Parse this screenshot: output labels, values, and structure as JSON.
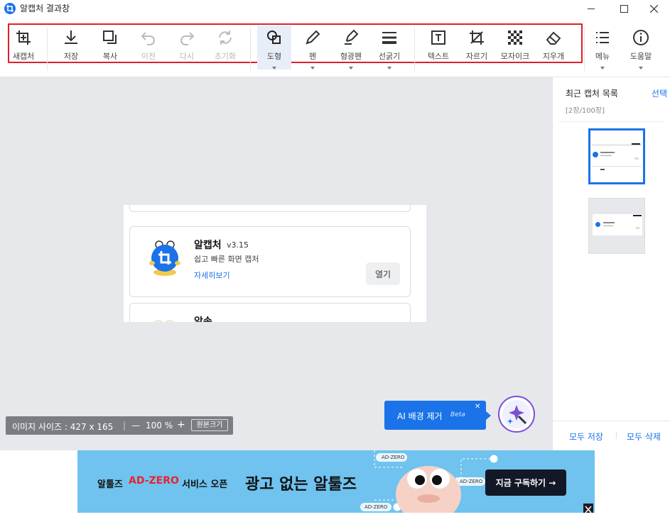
{
  "window": {
    "title": "알캡처 결과창"
  },
  "toolbar": {
    "new_capture": "새캡처",
    "save": "저장",
    "copy": "복사",
    "undo": "이전",
    "redo": "다시",
    "reset": "초기화",
    "shape": "도형",
    "pen": "펜",
    "highlighter": "형광펜",
    "line_thickness": "선굵기",
    "text": "텍스트",
    "crop": "자르기",
    "mosaic": "모자이크",
    "eraser": "지우개",
    "menu": "메뉴",
    "help": "도움말"
  },
  "canvas": {
    "app_card": {
      "name": "알캡처",
      "version": "v3.15",
      "description": "쉽고 빠른 화면 캡처",
      "details_link": "자세히보기",
      "open_button": "열기"
    },
    "next_card_title": "알송",
    "size_bar": {
      "label": "이미지 사이즈 : 427 x 165",
      "separator": "|",
      "zoom_out": "—",
      "zoom": "100 %",
      "zoom_in": "+",
      "original_size": "원본크기"
    },
    "ai_popup": {
      "label": "AI 배경 제거",
      "badge": "Beta",
      "close": "✕"
    }
  },
  "side_panel": {
    "title": "최근 캡처 목록",
    "select": "선택",
    "count": "[2장/100장]",
    "save_all": "모두 저장",
    "delete_all": "모두 삭제"
  },
  "ad": {
    "brand": "알툴즈",
    "highlight": "AD-ZERO",
    "service_open": "서비스 오픈",
    "headline": "광고 없는 알툴즈",
    "cta": "지금 구독하기 →",
    "tag": "AD-ZERO"
  },
  "colors": {
    "accent": "#1a73e8",
    "highlight_border": "#e01e2b",
    "ad_background": "#6fc3ee",
    "ad_text_red": "#e8232f"
  }
}
